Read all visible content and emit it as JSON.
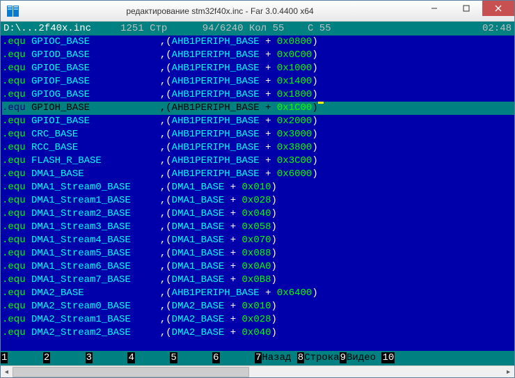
{
  "window": {
    "title": "редактирование stm32f40x.inc - Far 3.0.4400 x64"
  },
  "status": {
    "path": "D:\\...2f40x.inc",
    "codepage": "1251",
    "str_label": "Стр",
    "line_cur": "94",
    "line_total": "6240",
    "col_label": "Кол",
    "col": "55",
    "c_label": "С",
    "c_val": "55",
    "clock": "02:48"
  },
  "code": [
    {
      "h": false,
      "d": ".equ",
      "n": "GPIOC_BASE",
      "b": "AHB1PERIPH_BASE",
      "o": "0x0800",
      "c": false
    },
    {
      "h": false,
      "d": ".equ",
      "n": "GPIOD_BASE",
      "b": "AHB1PERIPH_BASE",
      "o": "0x0C00",
      "c": false
    },
    {
      "h": false,
      "d": ".equ",
      "n": "GPIOE_BASE",
      "b": "AHB1PERIPH_BASE",
      "o": "0x1000",
      "c": false
    },
    {
      "h": false,
      "d": ".equ",
      "n": "GPIOF_BASE",
      "b": "AHB1PERIPH_BASE",
      "o": "0x1400",
      "c": false
    },
    {
      "h": false,
      "d": ".equ",
      "n": "GPIOG_BASE",
      "b": "AHB1PERIPH_BASE",
      "o": "0x1800",
      "c": false
    },
    {
      "h": true,
      "d": ".equ",
      "n": "GPIOH_BASE",
      "b": "AHB1PERIPH_BASE",
      "o": "0x1C00",
      "c": true
    },
    {
      "h": false,
      "d": ".equ",
      "n": "GPIOI_BASE",
      "b": "AHB1PERIPH_BASE",
      "o": "0x2000",
      "c": false
    },
    {
      "h": false,
      "d": ".equ",
      "n": "CRC_BASE",
      "b": "AHB1PERIPH_BASE",
      "o": "0x3000",
      "c": false
    },
    {
      "h": false,
      "d": ".equ",
      "n": "RCC_BASE",
      "b": "AHB1PERIPH_BASE",
      "o": "0x3800",
      "c": false
    },
    {
      "h": false,
      "d": ".equ",
      "n": "FLASH_R_BASE",
      "b": "AHB1PERIPH_BASE",
      "o": "0x3C00",
      "c": false
    },
    {
      "h": false,
      "d": ".equ",
      "n": "DMA1_BASE",
      "b": "AHB1PERIPH_BASE",
      "o": "0x6000",
      "c": false
    },
    {
      "h": false,
      "d": ".equ",
      "n": "DMA1_Stream0_BASE",
      "b": "DMA1_BASE",
      "o": "0x010",
      "c": false
    },
    {
      "h": false,
      "d": ".equ",
      "n": "DMA1_Stream1_BASE",
      "b": "DMA1_BASE",
      "o": "0x028",
      "c": false
    },
    {
      "h": false,
      "d": ".equ",
      "n": "DMA1_Stream2_BASE",
      "b": "DMA1_BASE",
      "o": "0x040",
      "c": false
    },
    {
      "h": false,
      "d": ".equ",
      "n": "DMA1_Stream3_BASE",
      "b": "DMA1_BASE",
      "o": "0x058",
      "c": false
    },
    {
      "h": false,
      "d": ".equ",
      "n": "DMA1_Stream4_BASE",
      "b": "DMA1_BASE",
      "o": "0x070",
      "c": false
    },
    {
      "h": false,
      "d": ".equ",
      "n": "DMA1_Stream5_BASE",
      "b": "DMA1_BASE",
      "o": "0x088",
      "c": false
    },
    {
      "h": false,
      "d": ".equ",
      "n": "DMA1_Stream6_BASE",
      "b": "DMA1_BASE",
      "o": "0x0A0",
      "c": false
    },
    {
      "h": false,
      "d": ".equ",
      "n": "DMA1_Stream7_BASE",
      "b": "DMA1_BASE",
      "o": "0x0B8",
      "c": false
    },
    {
      "h": false,
      "d": ".equ",
      "n": "DMA2_BASE",
      "b": "AHB1PERIPH_BASE",
      "o": "0x6400",
      "c": false
    },
    {
      "h": false,
      "d": ".equ",
      "n": "DMA2_Stream0_BASE",
      "b": "DMA2_BASE",
      "o": "0x010",
      "c": false
    },
    {
      "h": false,
      "d": ".equ",
      "n": "DMA2_Stream1_BASE",
      "b": "DMA2_BASE",
      "o": "0x028",
      "c": false
    },
    {
      "h": false,
      "d": ".equ",
      "n": "DMA2_Stream2_BASE",
      "b": "DMA2_BASE",
      "o": "0x040",
      "c": false
    }
  ],
  "name_col_width": 22,
  "keybar": [
    {
      "n": "1",
      "l": "      "
    },
    {
      "n": "2",
      "l": "      "
    },
    {
      "n": "3",
      "l": "      "
    },
    {
      "n": "4",
      "l": "      "
    },
    {
      "n": "5",
      "l": "      "
    },
    {
      "n": "6",
      "l": "      "
    },
    {
      "n": "7",
      "l": "Назад "
    },
    {
      "n": "8",
      "l": "Строка"
    },
    {
      "n": "9",
      "l": "Видео "
    },
    {
      "n": "10",
      "l": "      "
    }
  ]
}
